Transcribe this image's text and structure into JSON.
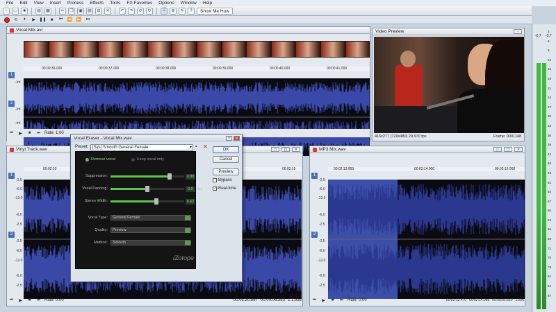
{
  "menu": [
    "File",
    "Edit",
    "View",
    "Insert",
    "Process",
    "Effects",
    "Tools",
    "FX Favorites",
    "Options",
    "Window",
    "Help"
  ],
  "toolbar": {
    "show_me_how": "Show Me How"
  },
  "vocal_mix": {
    "title": "Vocal Mix.avi",
    "times": [
      "00:00:36.000",
      "00:00:37.000",
      "00:00:38.000",
      "00:00:39.000",
      "00:00:40.000",
      "00:00:41.000"
    ],
    "db_labels": [
      "-Inf.",
      "-Inf.",
      "-Inf."
    ],
    "rate": "Rate: 1.00"
  },
  "video_preview": {
    "title": "Video Preview",
    "info": "416x277 (720x480)  29.970 fps",
    "frame": "Frame: 0001148"
  },
  "vinyl": {
    "title": "Vinyl Track.wav",
    "times": [
      "00:02:10",
      "00:02:15"
    ],
    "db_labels": [
      "-2.5",
      "-6.0",
      "-12.0",
      "-6.0",
      "-2.5",
      "-2.5",
      "-6.0",
      "-12.0",
      "-6.0",
      "-2.5"
    ],
    "rate": "Rate: 0.00",
    "pos1": "00:02:20.887",
    "pos2": "00:00:06.383",
    "zoom": "1:1,536"
  },
  "mp3": {
    "title": "MP3 Mix.wav",
    "times": [
      "00:02:13.000",
      "00:02:14.000",
      "00:02:15.000"
    ],
    "db_labels": [
      "-2.5",
      "-6.0",
      "-12.0",
      "-6.0",
      "-2.5",
      "-2.5",
      "-6.0",
      "-12.0",
      "-6.0",
      "-2.5"
    ],
    "rate": "Rate: 0.00",
    "pos1": "00:02:12.470",
    "pos2": "00:02:14.089",
    "pos3": "00:00:01.620",
    "zoom": "1:256"
  },
  "dialog": {
    "title": "Vocal Eraser - Vocal Mix.wav",
    "preset_label": "Preset:",
    "preset_value": "[Sys] Smooth General Female",
    "ok": "OK",
    "cancel": "Cancel",
    "preview": "Preview",
    "bypass": "Bypass",
    "realtime": "Real-time",
    "remove_vocal": "Remove vocal",
    "keep_vocal": "Keep vocal only",
    "suppression_label": "Suppression:",
    "suppression_value": "0.80",
    "suppression_level": 0.8,
    "panning_label": "Vocal Panning:",
    "panning_value": "0.0",
    "panning_unit": "deg",
    "panning_level": 0.5,
    "width_label": "Stereo Width:",
    "width_value": "0.62",
    "width_level": 0.62,
    "type_label": "Vocal Type:",
    "type_value": "General Female",
    "quality_label": "Quality:",
    "quality_value": "Preview",
    "method_label": "Method:",
    "method_value": "Smooth",
    "brand": "iZotope"
  },
  "vu": {
    "left": "-0.7",
    "right": "-0.7",
    "scale": [
      "3",
      "6",
      "9",
      "12",
      "15",
      "18",
      "21",
      "24",
      "27",
      "30",
      "33",
      "36",
      "39",
      "42",
      "45",
      "48",
      "51",
      "54",
      "57",
      "60",
      "63",
      "66",
      "69",
      "72",
      "75",
      "78",
      "81",
      "84",
      "87"
    ]
  }
}
